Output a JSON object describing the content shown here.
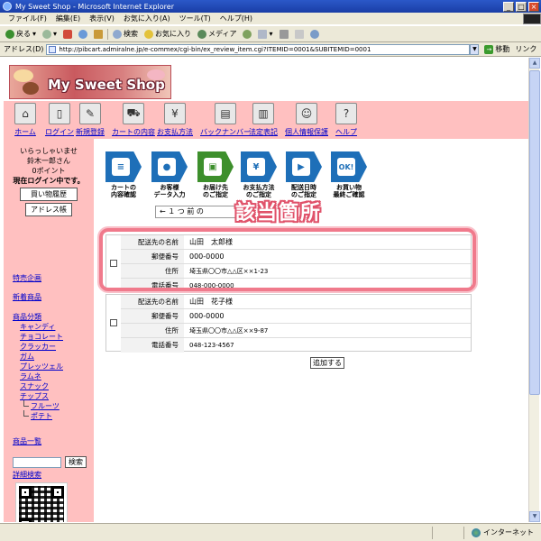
{
  "window": {
    "title": "My Sweet Shop - Microsoft Internet Explorer"
  },
  "menu": [
    "ファイル(F)",
    "編集(E)",
    "表示(V)",
    "お気に入り(A)",
    "ツール(T)",
    "ヘルプ(H)"
  ],
  "toolbar": {
    "back": "戻る",
    "search": "検索",
    "favorites": "お気に入り",
    "media": "メディア"
  },
  "address": {
    "label": "アドレス(D)",
    "url": "http://pibcart.admiralne.jp/e-commex/cgi-bin/ex_review_item.cgi?ITEMID=0001&SUBITEMID=0001",
    "go": "移動",
    "links": "リンク"
  },
  "site": {
    "logo": "My Sweet Shop",
    "nav": [
      {
        "label": "ホーム",
        "icon": "home-icon"
      },
      {
        "label": "ログイン",
        "icon": "login-door-icon"
      },
      {
        "label": "新規登録",
        "icon": "signature-pen-icon"
      },
      {
        "label": "カートの内容",
        "icon": "shopping-cart-icon"
      },
      {
        "label": "お支払方法",
        "icon": "yen-register-icon"
      },
      {
        "label": "バックナンバー",
        "icon": "magazine-icon"
      },
      {
        "label": "法定表記",
        "icon": "document-icon"
      },
      {
        "label": "個人情報保護",
        "icon": "person-icon"
      },
      {
        "label": "ヘルプ",
        "icon": "question-icon"
      }
    ]
  },
  "sidebar": {
    "welcome": "いらっしゃいませ",
    "user": "鈴木一郎さん",
    "points": "0ポイント",
    "login_status": "現在ログイン中です。",
    "history_button": "買い物履歴",
    "address_button": "アドレス帳",
    "links": {
      "special": "特売企画",
      "new": "新着商品",
      "category": "商品分類",
      "candy": "キャンディ",
      "chocolate": "チョコレート",
      "cracker": "クラッカー",
      "gum": "ガム",
      "pretzel": "プレッツェル",
      "ramune": "ラムネ",
      "snack": "スナック",
      "chips": "チップス",
      "fruit": "フルーツ",
      "potato": "ポテト",
      "list": "商品一覧",
      "advanced": "詳細検索"
    },
    "search_button": "検索"
  },
  "steps": [
    {
      "label": "カートの\n内容確認",
      "icon": "cart-step-icon",
      "glyph": "≡"
    },
    {
      "label": "お客様\nデータ入力",
      "icon": "customer-step-icon",
      "glyph": "●"
    },
    {
      "label": "お届け先\nのご指定",
      "icon": "delivery-box-step-icon",
      "glyph": "▣"
    },
    {
      "label": "お支払方法\nのご指定",
      "icon": "yen-card-step-icon",
      "glyph": "¥"
    },
    {
      "label": "配送日時\nのご指定",
      "icon": "truck-step-icon",
      "glyph": "▶"
    },
    {
      "label": "お買い物\n最終ご確認",
      "icon": "ok-step-icon",
      "glyph": "OK!"
    }
  ],
  "pager": "← １ つ 前 の",
  "highlight": "該当箇所",
  "addresses": [
    {
      "name_label": "配送先の名前",
      "name": "山田　太郎様",
      "zip_label": "郵便番号",
      "zip": "000-0000",
      "addr_label": "住所",
      "addr": "埼玉県〇〇市△△区××1-23",
      "tel_label": "電話番号",
      "tel": "048-000-0000"
    },
    {
      "name_label": "配送先の名前",
      "name": "山田　花子様",
      "zip_label": "郵便番号",
      "zip": "000-0000",
      "addr_label": "住所",
      "addr": "埼玉県〇〇市△△区××9-87",
      "tel_label": "電話番号",
      "tel": "048-123-4567"
    }
  ],
  "add_button": "追加する",
  "status": {
    "zone": "インターネット"
  }
}
